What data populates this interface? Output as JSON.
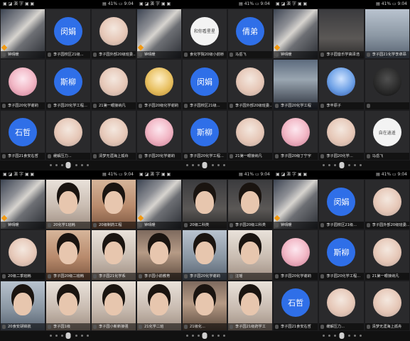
{
  "screens": [
    {
      "status": {
        "left": "▣ ◪ 演 字 ▣ ▣",
        "right": "▤ 41% ▭ 9:04"
      },
      "tiles": [
        {
          "type": "video",
          "style": "v-class",
          "label": "钟晴暖",
          "host": true
        },
        {
          "type": "avatar",
          "color": "blue",
          "text": "闵娟",
          "label": "李子园校区21级..."
        },
        {
          "type": "avatar",
          "color": "img",
          "text": "",
          "label": "李子园外部20级班委..."
        },
        {
          "type": "avatar",
          "color": "img pink",
          "text": "",
          "label": "李子园20化学谢莉"
        },
        {
          "type": "avatar",
          "color": "blue",
          "text": "斯柳",
          "label": "李子园20化学工程..."
        },
        {
          "type": "avatar",
          "color": "img",
          "text": "",
          "label": "21第一眼接纳凡"
        },
        {
          "type": "avatar",
          "color": "blue",
          "text": "石哲",
          "label": "李子园21食安右哲"
        },
        {
          "type": "avatar",
          "color": "img",
          "text": "",
          "label": "缓解压力..."
        },
        {
          "type": "avatar",
          "color": "img",
          "text": "",
          "label": "清梦无涯海上孤舟"
        }
      ]
    },
    {
      "status": {
        "left": "▣ ◪ 演 字 ▣ ▣",
        "right": "▤ 41% ▭ 9:04"
      },
      "tiles": [
        {
          "type": "video",
          "style": "v-class",
          "label": "钟晴暖",
          "host": true
        },
        {
          "type": "avatar",
          "color": "img white",
          "text": "和你看星星",
          "label": "食化学院20级小前桥"
        },
        {
          "type": "avatar",
          "color": "blue",
          "text": "倩弟",
          "label": "马岳飞"
        },
        {
          "type": "avatar",
          "color": "img gold",
          "text": "",
          "label": "李子园20级化学谢莉"
        },
        {
          "type": "avatar",
          "color": "blue",
          "text": "闵娟",
          "label": "李子园校区21级..."
        },
        {
          "type": "avatar",
          "color": "img",
          "text": "",
          "label": "李子园外部20级班委..."
        },
        {
          "type": "avatar",
          "color": "img pink",
          "text": "",
          "label": "李子园20化学谢莉"
        },
        {
          "type": "avatar",
          "color": "blue",
          "text": "斯柳",
          "label": "李子园20化学工程..."
        },
        {
          "type": "avatar",
          "color": "img",
          "text": "",
          "label": "21第一眼接纳凡"
        }
      ]
    },
    {
      "status": {
        "left": "▣ ◪ 演 字 ▣ ▣",
        "right": "▤ 41% ▭ 9:04"
      },
      "tiles": [
        {
          "type": "video",
          "style": "v-class",
          "label": "钟晴暖",
          "host": true
        },
        {
          "type": "video",
          "style": "v-dim",
          "label": "李子园音乐学高泽浩"
        },
        {
          "type": "video",
          "style": "v-cool",
          "label": "李子园21化学李卓昂"
        },
        {
          "type": "video",
          "style": "v-sky",
          "label": "李子园20化学工程"
        },
        {
          "type": "avatar",
          "color": "img blue2",
          "text": "",
          "label": "李丰原子"
        },
        {
          "type": "avatar",
          "color": "img dark",
          "text": "",
          "label": ""
        },
        {
          "type": "avatar",
          "color": "img pink",
          "text": "",
          "label": "李子园20级丁宁宇"
        },
        {
          "type": "avatar",
          "color": "img",
          "text": "",
          "label": "李子园20化学..."
        },
        {
          "type": "avatar",
          "color": "img white",
          "text": "自在逍遥",
          "label": "马岳飞"
        }
      ]
    },
    {
      "status": {
        "left": "▣ ◪ 演 字 ▣ ▣",
        "right": "▤ 41% ▭ 9:04"
      },
      "tiles": [
        {
          "type": "video",
          "style": "v-class",
          "label": "钟晴暖",
          "host": true
        },
        {
          "type": "video",
          "style": "v-light",
          "label": "20化学1班韩",
          "face": true
        },
        {
          "type": "video",
          "style": "v-warm",
          "label": "20级制药工程",
          "face": true
        },
        {
          "type": "avatar",
          "color": "img",
          "text": "",
          "label": "20级二季班韩"
        },
        {
          "type": "video",
          "style": "v-warm",
          "label": "李子园20级二班韩",
          "face": true
        },
        {
          "type": "video",
          "style": "v-light",
          "label": "李子园21化学系",
          "face": true
        },
        {
          "type": "video",
          "style": "v-cool",
          "label": "20食安胡锦航",
          "face": true
        },
        {
          "type": "video",
          "style": "v-light",
          "label": "李子园1级",
          "face": true
        },
        {
          "type": "video",
          "style": "v-light",
          "label": "李子园小新新接强",
          "face": true
        }
      ]
    },
    {
      "status": {
        "left": "▣ ◪ 演 字 ▣ ▣",
        "right": "▤ 41% ▭ 9:04"
      },
      "tiles": [
        {
          "type": "video",
          "style": "v-class",
          "label": "钟晴暖",
          "host": true
        },
        {
          "type": "video",
          "style": "v-dim",
          "label": "20级二科类",
          "face": true
        },
        {
          "type": "video",
          "style": "v-dim",
          "label": "李子园20级三科类",
          "face": true
        },
        {
          "type": "video",
          "style": "v-room",
          "label": "李子园小前教育",
          "face": true
        },
        {
          "type": "video",
          "style": "v-cool",
          "label": "李子园20化学谢莉",
          "face": true
        },
        {
          "type": "video",
          "style": "v-light",
          "label": "汪瑶",
          "face": true
        },
        {
          "type": "video",
          "style": "v-light",
          "label": "21化学二班",
          "face": true
        },
        {
          "type": "video",
          "style": "v-room",
          "label": "21级化...",
          "face": true
        },
        {
          "type": "video",
          "style": "v-light",
          "label": "李子园21级药学工",
          "face": true
        }
      ]
    },
    {
      "status": {
        "left": "▣ ◪ 演 字 ▣ ▣",
        "right": "▤ 41% ▭ 9:04"
      },
      "tiles": [
        {
          "type": "video",
          "style": "v-class",
          "label": "钟晴暖",
          "host": true
        },
        {
          "type": "avatar",
          "color": "blue",
          "text": "闵娟",
          "label": "李子园校区21级..."
        },
        {
          "type": "avatar",
          "color": "img",
          "text": "",
          "label": "李子园外部20级班委..."
        },
        {
          "type": "avatar",
          "color": "img pink",
          "text": "",
          "label": "李子园20化学谢莉"
        },
        {
          "type": "avatar",
          "color": "blue",
          "text": "斯柳",
          "label": "李子园20化学工程..."
        },
        {
          "type": "avatar",
          "color": "img",
          "text": "",
          "label": "21第一眼接纳凡"
        },
        {
          "type": "avatar",
          "color": "blue",
          "text": "石哲",
          "label": "李子园21食安右哲"
        },
        {
          "type": "avatar",
          "color": "img",
          "text": "",
          "label": "缓解压力..."
        },
        {
          "type": "avatar",
          "color": "img",
          "text": "",
          "label": "清梦无涯海上孤舟"
        }
      ]
    }
  ]
}
